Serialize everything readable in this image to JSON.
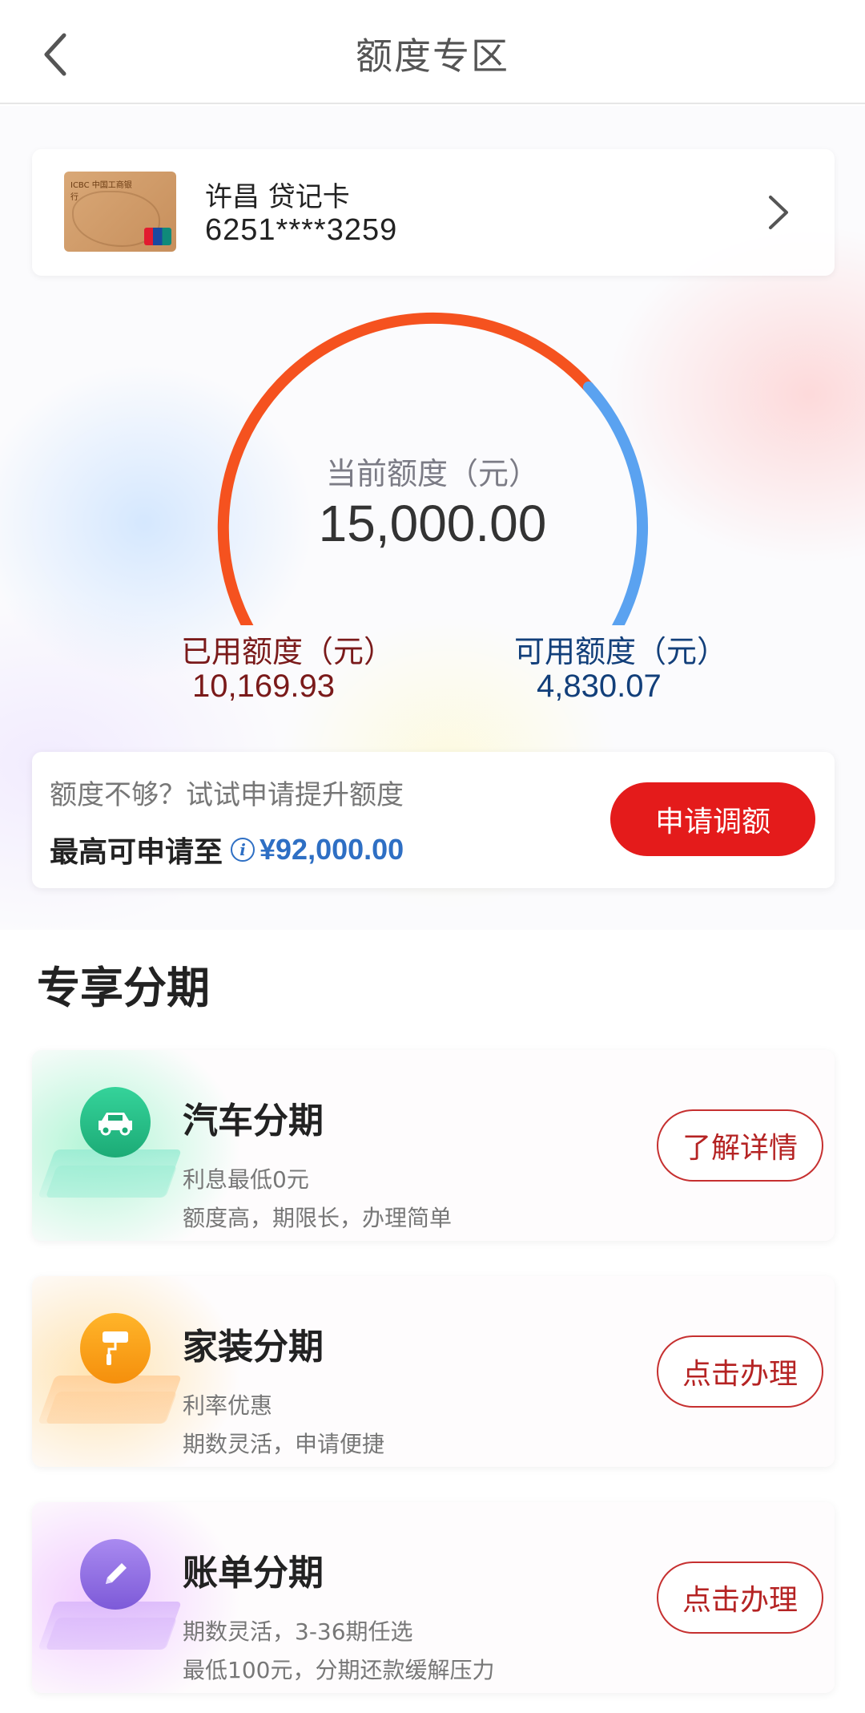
{
  "header": {
    "title": "额度专区"
  },
  "card": {
    "name": "许昌 贷记卡",
    "number": "6251****3259",
    "logo_text": "ICBC 中国工商银行"
  },
  "gauge": {
    "caption": "当前额度（元）",
    "total": "15,000.00",
    "used_fraction": 0.678,
    "used_label": "已用额度（元）",
    "used_value": "10,169.93",
    "available_label": "可用额度（元）",
    "available_value": "4,830.07",
    "colors": {
      "used": "#f5521f",
      "available": "#5aa2f0"
    }
  },
  "promo": {
    "question": "额度不够？试试申请提升额度",
    "max_label": "最高可申请至",
    "max_amount": "¥92,000.00",
    "apply_button": "申请调额"
  },
  "section": {
    "title": "专享分期"
  },
  "items": [
    {
      "title": "汽车分期",
      "line1": "利息最低0元",
      "line2": "额度高，期限长，办理简单",
      "button": "了解详情",
      "icon": "car-icon",
      "accent": "#2bc38a"
    },
    {
      "title": "家装分期",
      "line1": "利率优惠",
      "line2": "期数灵活，申请便捷",
      "button": "点击办理",
      "icon": "paint-roller-icon",
      "accent": "#f9a21b"
    },
    {
      "title": "账单分期",
      "line1": "期数灵活，3-36期任选",
      "line2": "最低100元，分期还款缓解压力",
      "button": "点击办理",
      "icon": "pencil-icon",
      "accent": "#9b7ae6"
    }
  ]
}
